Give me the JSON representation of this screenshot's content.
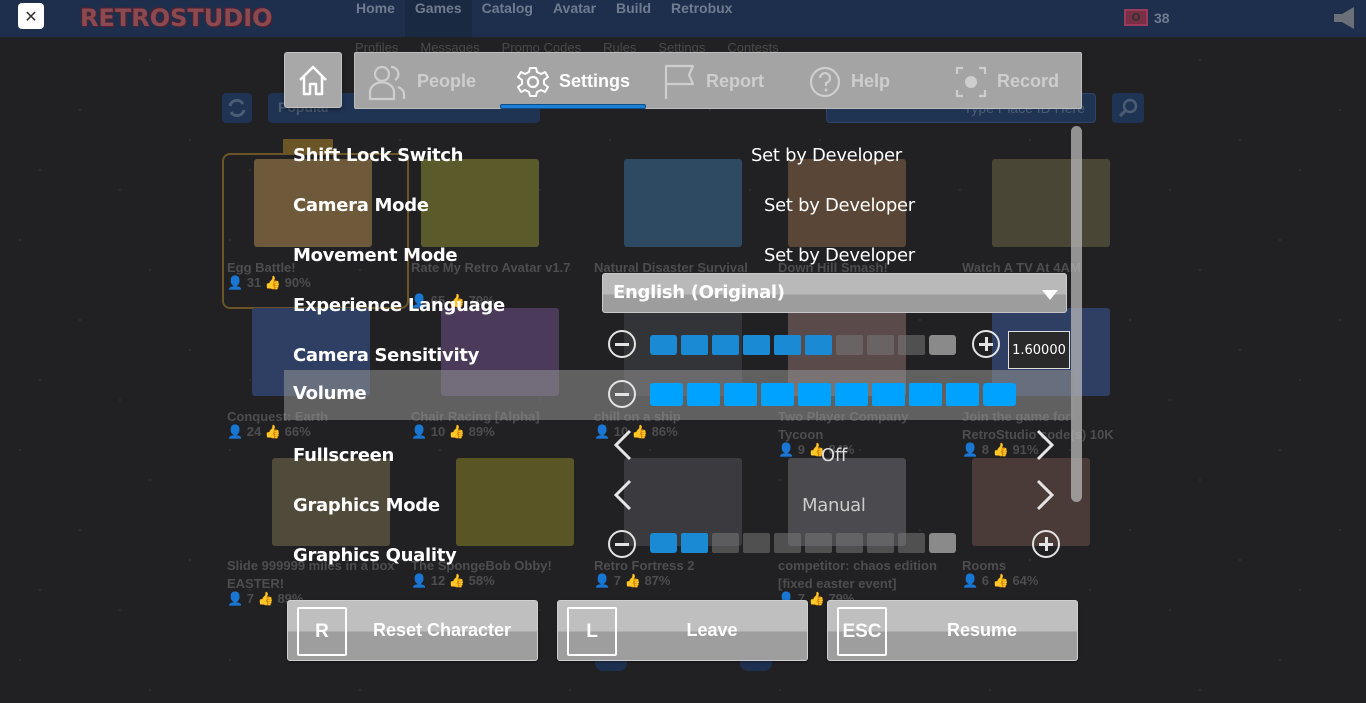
{
  "site": {
    "close_label": "✕",
    "logo": "RETROSTUDIO",
    "nav": [
      "Home",
      "Games",
      "Catalog",
      "Avatar",
      "Build",
      "Retrobux"
    ],
    "active_nav": "Games",
    "currency_icon": "robux-icon",
    "currency_count": "38",
    "sub_nav": [
      "Profiles",
      "Messages",
      "Promo Codes",
      "Rules",
      "Settings",
      "Contests"
    ],
    "category_select": "Popular",
    "place_input_placeholder": "Type Place ID Here"
  },
  "games": [
    {
      "title": "Egg Battle!",
      "players": "31",
      "rating": "90%",
      "color": "#6e5a3a"
    },
    {
      "title": "Rate My Retro Avatar v1.7",
      "players": "65",
      "rating": "79%",
      "color": "#5b5a2a"
    },
    {
      "title": "Natural Disaster Survival",
      "players": "",
      "rating": "",
      "color": "#2e4a63"
    },
    {
      "title": "Down Hill Smash!",
      "players": "",
      "rating": "",
      "color": "#5a4636"
    },
    {
      "title": "Watch A TV At 4AM",
      "players": "",
      "rating": "",
      "color": "#4a4636"
    },
    {
      "title": "Conquest: Earth",
      "players": "24",
      "rating": "66%",
      "color": "#2f3f63"
    },
    {
      "title": "Chair Racing [Alpha]",
      "players": "10",
      "rating": "89%",
      "color": "#4b3a5a"
    },
    {
      "title": "chill on a ship",
      "players": "10",
      "rating": "86%",
      "color": "#333438"
    },
    {
      "title": "Two Player Company Tycoon",
      "players": "9",
      "rating": "84%",
      "color": "#5a4a4a"
    },
    {
      "title": "Join the game for RetroStudio code(s) 10K",
      "players": "8",
      "rating": "91%",
      "color": "#2f3f63"
    },
    {
      "title": "Slide 999999 miles in a box EASTER!",
      "players": "7",
      "rating": "89%",
      "color": "#4f4a3a"
    },
    {
      "title": "The SpongeBob Obby!",
      "players": "12",
      "rating": "58%",
      "color": "#5a5524"
    },
    {
      "title": "Retro Fortress 2",
      "players": "7",
      "rating": "87%",
      "color": "#3a3a3f"
    },
    {
      "title": "competitor: chaos edition [fixed easter event]",
      "players": "7",
      "rating": "79%",
      "color": "#4a4a4f"
    },
    {
      "title": "Rooms",
      "players": "6",
      "rating": "64%",
      "color": "#4a3a38"
    }
  ],
  "menu": {
    "tabs": [
      {
        "label": "People",
        "icon": "people-icon"
      },
      {
        "label": "Settings",
        "icon": "gear-icon"
      },
      {
        "label": "Report",
        "icon": "flag-icon"
      },
      {
        "label": "Help",
        "icon": "help-icon"
      },
      {
        "label": "Record",
        "icon": "record-icon"
      }
    ],
    "active_tab": "Settings",
    "accent": "#1b7fd6"
  },
  "settings": {
    "shift_lock": {
      "label": "Shift Lock Switch",
      "value": "Set by Developer"
    },
    "camera_mode": {
      "label": "Camera Mode",
      "value": "Set by Developer"
    },
    "movement_mode": {
      "label": "Movement Mode",
      "value": "Set by Developer"
    },
    "language": {
      "label": "Experience Language",
      "value": "English (Original)"
    },
    "camera_sensitivity": {
      "label": "Camera Sensitivity",
      "value": "1.60000",
      "filled_steps": 6,
      "total_steps": 10
    },
    "volume": {
      "label": "Volume",
      "filled_steps": 10,
      "total_steps": 10
    },
    "fullscreen": {
      "label": "Fullscreen",
      "value": "Off"
    },
    "graphics_mode": {
      "label": "Graphics Mode",
      "value": "Manual"
    },
    "graphics_quality": {
      "label": "Graphics Quality",
      "filled_steps": 2,
      "total_steps": 10
    }
  },
  "actions": [
    {
      "key": "R",
      "label": "Reset Character"
    },
    {
      "key": "L",
      "label": "Leave"
    },
    {
      "key": "ESC",
      "label": "Resume"
    }
  ]
}
